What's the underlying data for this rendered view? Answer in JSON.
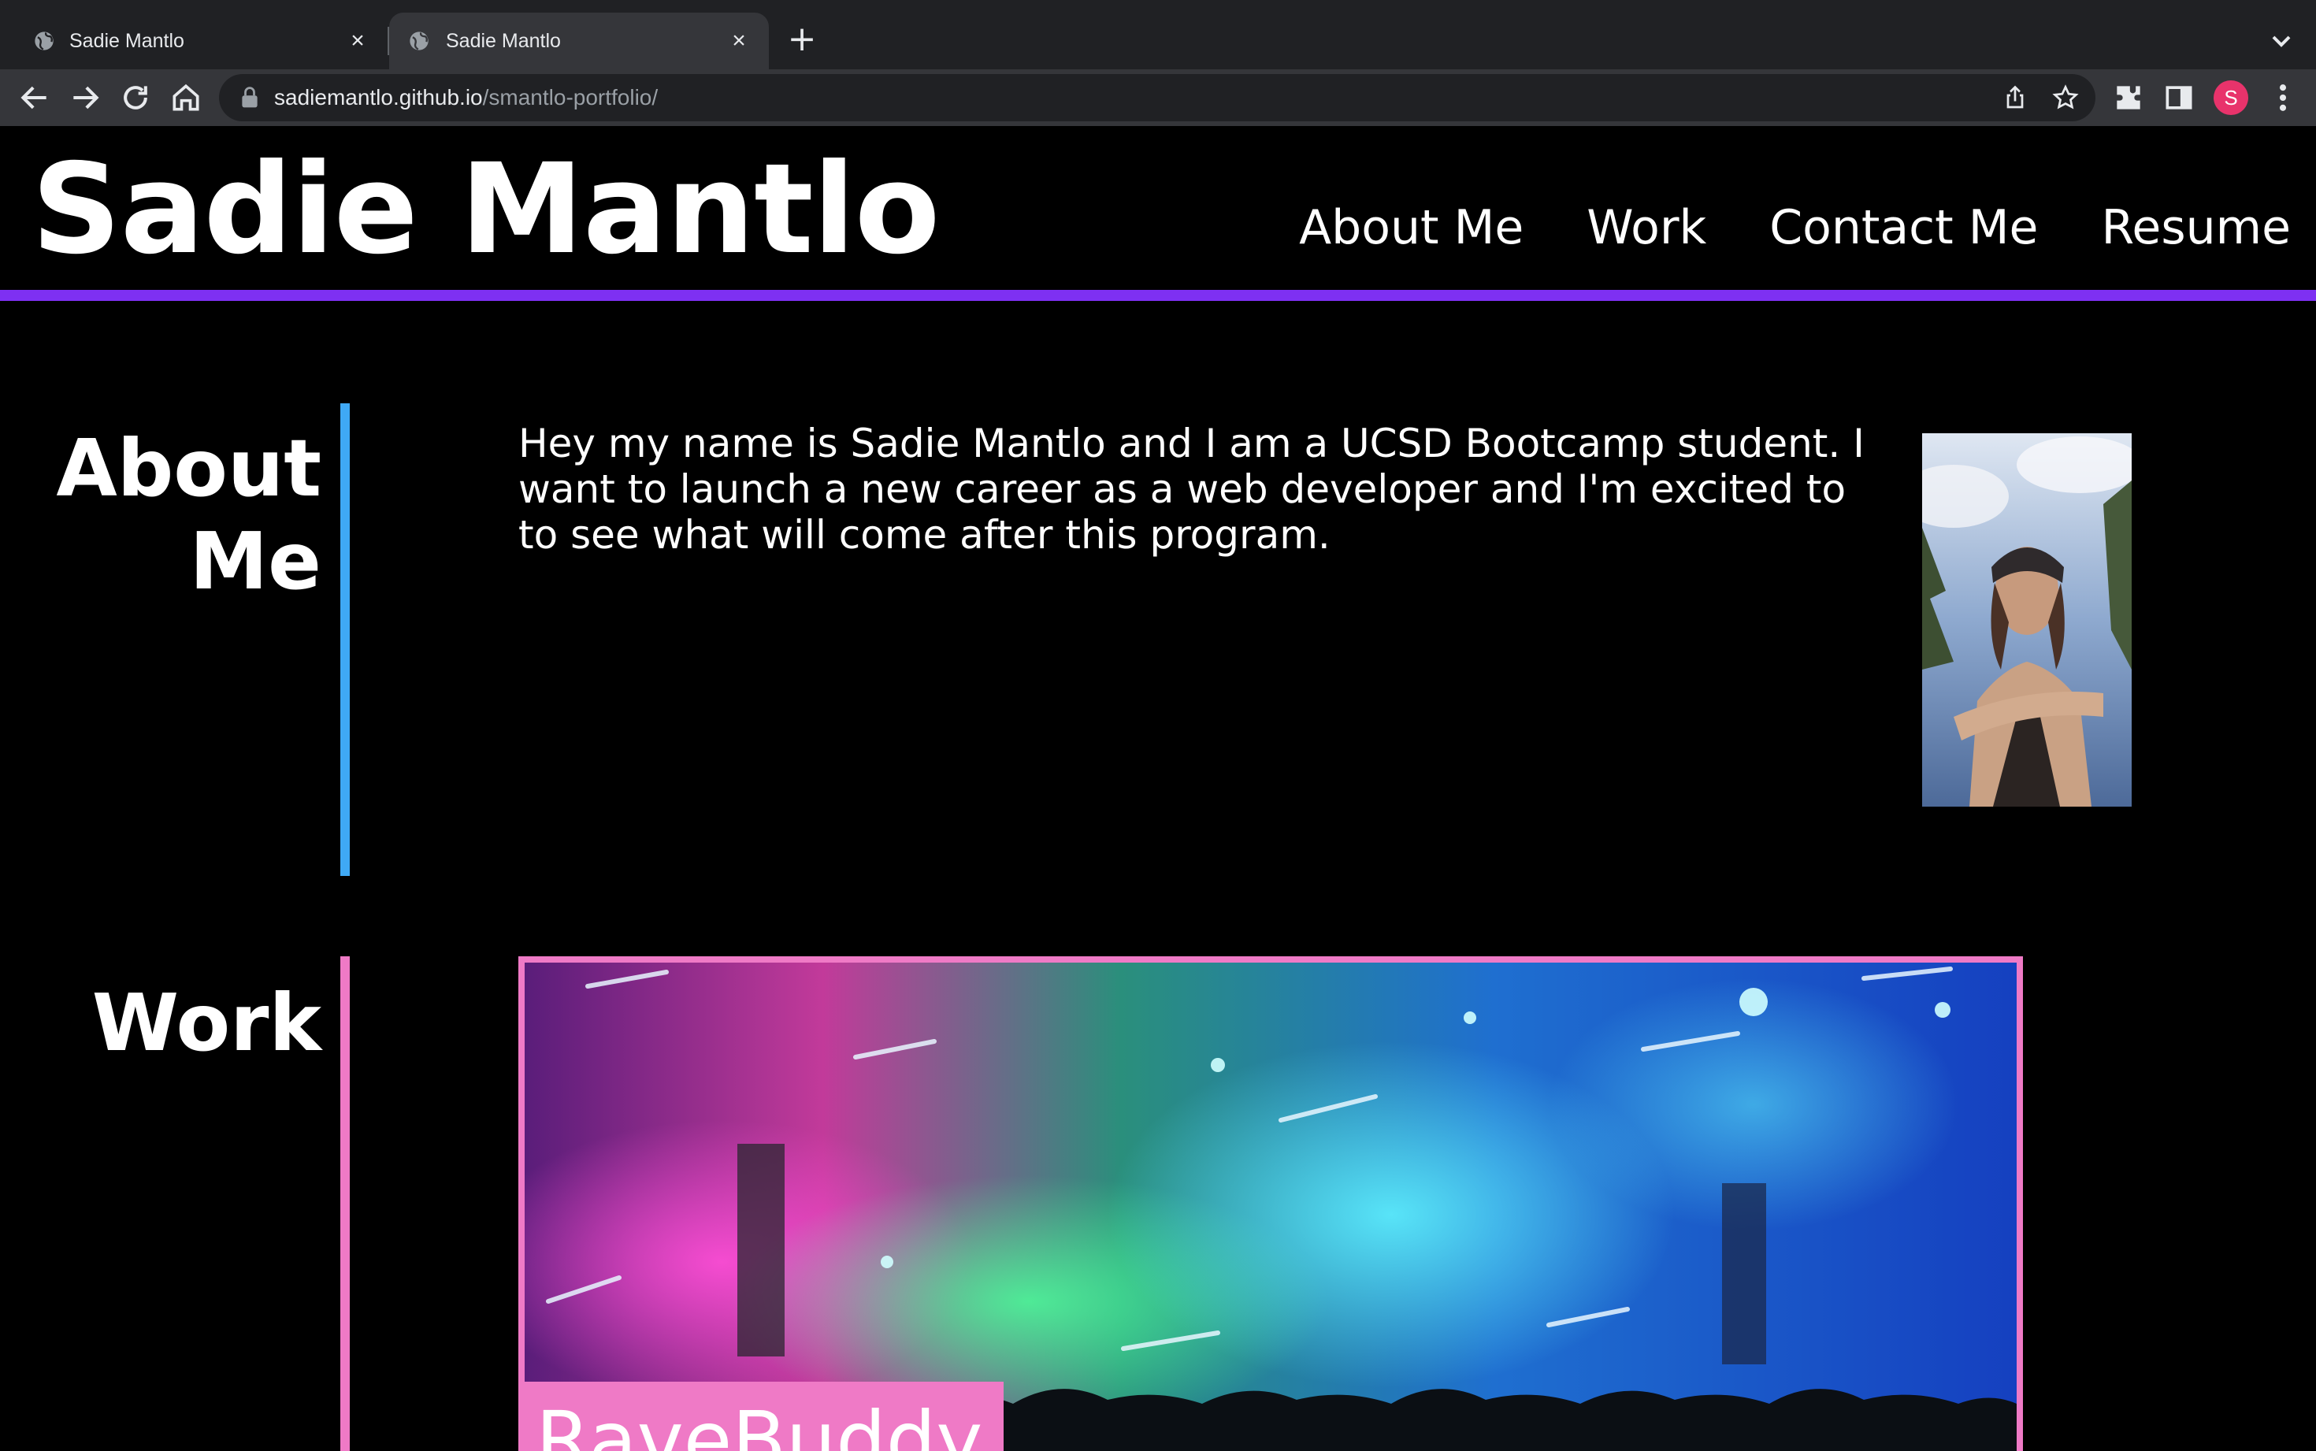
{
  "browser": {
    "tabs": [
      {
        "title": "Sadie Mantlo",
        "close_label": "×"
      },
      {
        "title": "Sadie Mantlo",
        "close_label": "×"
      }
    ],
    "new_tab_label": "+",
    "url_host": "sadiemantlo.github.io",
    "url_path": "/smantlo-portfolio/",
    "profile_initial": "S",
    "profile_color": "#e8336b"
  },
  "site": {
    "title": "Sadie Mantlo",
    "nav": [
      "About Me",
      "Work",
      "Contact Me",
      "Resume"
    ],
    "accent_color": "#7e30f2"
  },
  "about": {
    "heading": "About Me",
    "text": "Hey my name is Sadie Mantlo and I am a UCSD Bootcamp student. I want to launch a new career as a web developer and I'm excited to to see what will come after this program.",
    "rule_color": "#3fa9f5"
  },
  "work": {
    "heading": "Work",
    "project_title": "RaveBuddy",
    "rule_color": "#ef7ac6"
  }
}
